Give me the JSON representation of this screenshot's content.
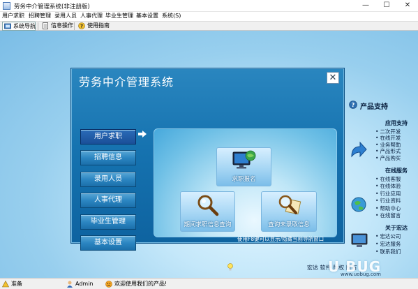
{
  "window": {
    "title": "劳务中介管理系统(非注册版)",
    "minimize": "—",
    "maximize": "☐",
    "close": "✕"
  },
  "menubar": {
    "items": [
      "用户求职",
      "招聘管理",
      "录用人员",
      "人事代理",
      "毕业生管理",
      "基本设置",
      "系统(S)"
    ]
  },
  "toolbar": {
    "items": [
      {
        "label": "系统导航",
        "icon": "navigator-icon"
      },
      {
        "label": "信息操作",
        "icon": "document-icon"
      },
      {
        "label": "使用指南",
        "icon": "help-icon"
      }
    ]
  },
  "dialog": {
    "title": "劳务中介管理系统",
    "close": "✕",
    "nav": [
      "用户求职",
      "招聘信息",
      "录用人员",
      "人事代理",
      "毕业生管理",
      "基本设置"
    ],
    "nav_selected": "用户求职",
    "panel": {
      "job_register": "求职报名",
      "period_query": "期间求职信息查询",
      "unhired_query": "查询未录取信息"
    },
    "hint": "使用F8键可以显示/隐藏当前导航窗口"
  },
  "side": {
    "header": "产品支持",
    "sections": [
      {
        "title": "应用支持",
        "items": [
          "二次开发",
          "在线开发",
          "业务帮助",
          "产品形式",
          "产品购买"
        ]
      },
      {
        "title": "在线服务",
        "items": [
          "在线客服",
          "在线体验",
          "行业应用",
          "行业资料",
          "帮助中心",
          "在线留言"
        ]
      },
      {
        "title": "关于宏达",
        "items": [
          "宏达公司",
          "宏达服务",
          "联系我们"
        ]
      }
    ],
    "bottom_text": "宏达 软件 版权 所有"
  },
  "statusbar": {
    "items": [
      {
        "label": "准备",
        "icon": "ready-icon"
      },
      {
        "label": "Admin",
        "icon": "user-icon"
      },
      {
        "label": "欢迎使用我们的产品!",
        "icon": "welcome-icon"
      }
    ]
  },
  "watermark": {
    "text": "U BUG",
    "sub": "www.uobug.com"
  },
  "colors": {
    "accent": "#1673b0",
    "panel": "#6fc0e6",
    "nav_active": "#1a4f98"
  }
}
